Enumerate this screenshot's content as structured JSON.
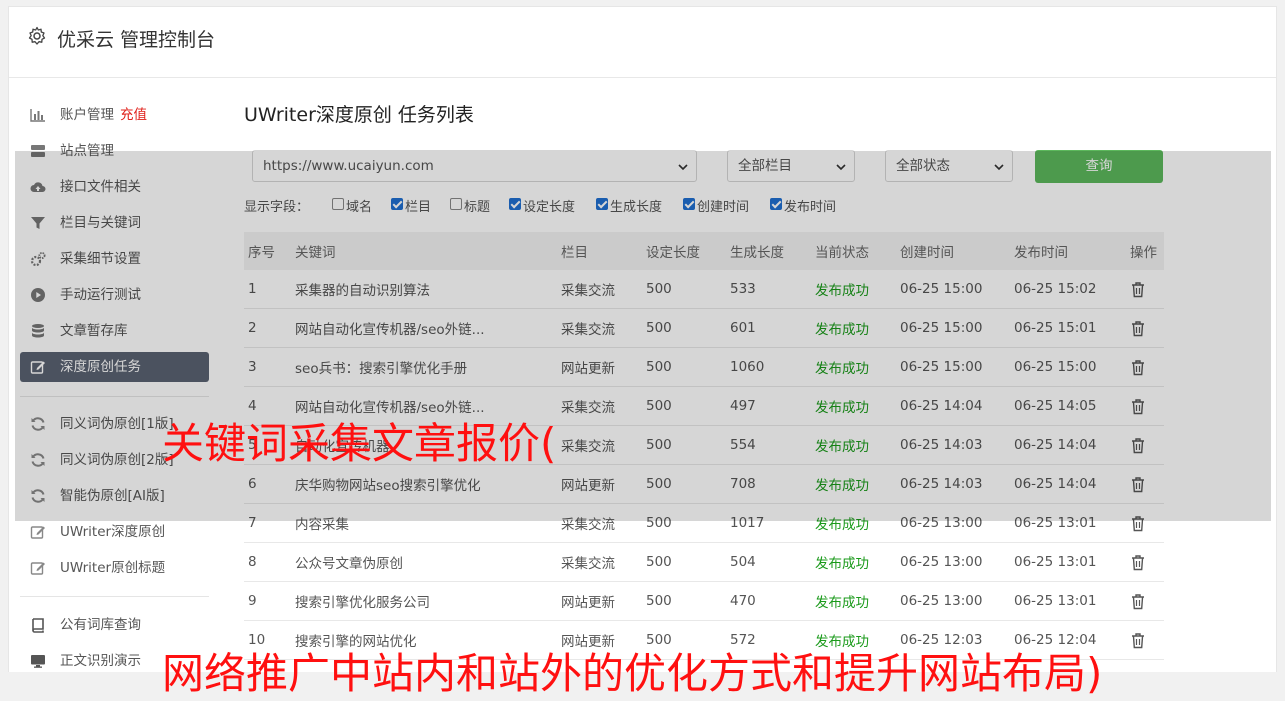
{
  "header": {
    "title": "优采云 管理控制台"
  },
  "sidebar": {
    "items": [
      {
        "label": "账户管理",
        "badge": "充值",
        "icon": "bar-chart-icon"
      },
      {
        "label": "站点管理",
        "icon": "server-icon"
      },
      {
        "label": "接口文件相关",
        "icon": "cloud-upload-icon"
      },
      {
        "label": "栏目与关键词",
        "icon": "filter-icon"
      },
      {
        "label": "采集细节设置",
        "icon": "gears-icon"
      },
      {
        "label": "手动运行测试",
        "icon": "play-circle-icon"
      },
      {
        "label": "文章暂存库",
        "icon": "database-icon"
      },
      {
        "label": "深度原创任务",
        "icon": "edit-icon"
      },
      {
        "label": "同义词伪原创[1版]",
        "icon": "refresh-icon"
      },
      {
        "label": "同义词伪原创[2版]",
        "icon": "refresh-icon"
      },
      {
        "label": "智能伪原创[AI版]",
        "icon": "refresh-icon"
      },
      {
        "label": "UWriter深度原创",
        "icon": "edit-icon"
      },
      {
        "label": "UWriter原创标题",
        "icon": "edit-icon"
      },
      {
        "label": "公有词库查询",
        "icon": "book-icon"
      },
      {
        "label": "正文识别演示",
        "icon": "monitor-icon"
      }
    ]
  },
  "main": {
    "title": "UWriter深度原创 任务列表",
    "site_select": "https://www.ucaiyun.com",
    "column_select": "全部栏目",
    "status_select": "全部状态",
    "query_button": "查询",
    "fields_label": "显示字段：",
    "fields": [
      {
        "label": "域名",
        "checked": false
      },
      {
        "label": "栏目",
        "checked": true
      },
      {
        "label": "标题",
        "checked": false
      },
      {
        "label": "设定长度",
        "checked": true
      },
      {
        "label": "生成长度",
        "checked": true
      },
      {
        "label": "创建时间",
        "checked": true
      },
      {
        "label": "发布时间",
        "checked": true
      }
    ],
    "columns": [
      "序号",
      "关键词",
      "栏目",
      "设定长度",
      "生成长度",
      "当前状态",
      "创建时间",
      "发布时间",
      "操作"
    ],
    "rows": [
      [
        "1",
        "采集器的自动识别算法",
        "采集交流",
        "500",
        "533",
        "发布成功",
        "06-25 15:00",
        "06-25 15:02"
      ],
      [
        "2",
        "网站自动化宣传机器/seo外链...",
        "采集交流",
        "500",
        "601",
        "发布成功",
        "06-25 15:00",
        "06-25 15:01"
      ],
      [
        "3",
        "seo兵书：搜索引擎优化手册",
        "网站更新",
        "500",
        "1060",
        "发布成功",
        "06-25 15:00",
        "06-25 15:00"
      ],
      [
        "4",
        "网站自动化宣传机器/seo外链...",
        "采集交流",
        "500",
        "497",
        "发布成功",
        "06-25 14:04",
        "06-25 14:05"
      ],
      [
        "5",
        "自动化宣传机器",
        "采集交流",
        "500",
        "554",
        "发布成功",
        "06-25 14:03",
        "06-25 14:04"
      ],
      [
        "6",
        "庆华购物网站seo搜索引擎优化",
        "网站更新",
        "500",
        "708",
        "发布成功",
        "06-25 14:03",
        "06-25 14:04"
      ],
      [
        "7",
        "内容采集",
        "采集交流",
        "500",
        "1017",
        "发布成功",
        "06-25 13:00",
        "06-25 13:01"
      ],
      [
        "8",
        "公众号文章伪原创",
        "采集交流",
        "500",
        "504",
        "发布成功",
        "06-25 13:00",
        "06-25 13:01"
      ],
      [
        "9",
        "搜索引擎优化服务公司",
        "网站更新",
        "500",
        "470",
        "发布成功",
        "06-25 13:00",
        "06-25 13:01"
      ],
      [
        "10",
        "搜索引擎的网站优化",
        "网站更新",
        "500",
        "572",
        "发布成功",
        "06-25 12:03",
        "06-25 12:04"
      ]
    ]
  },
  "overlay_texts": {
    "caption1": "关键词采集文章报价(",
    "caption2": "网络推广中站内和站外的优化方式和提升网站布局)"
  },
  "colors": {
    "accent": "#5cb85c",
    "active_nav": "#5a6272",
    "success": "#1a9a1a",
    "overlay_red": "#ff1010"
  }
}
